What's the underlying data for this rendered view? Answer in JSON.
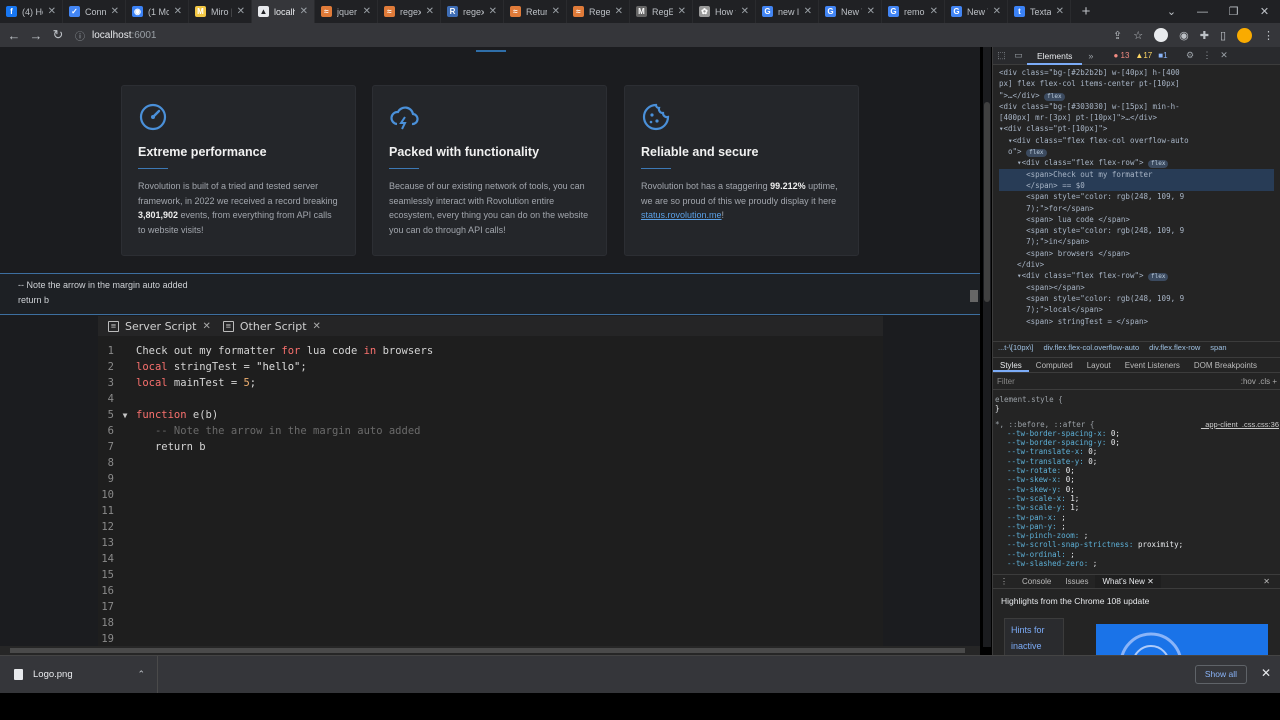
{
  "tabs": [
    {
      "title": "(4) Ho",
      "color": "#1877f2",
      "glyph": "f"
    },
    {
      "title": "Conn",
      "color": "#4285f4",
      "glyph": "✓"
    },
    {
      "title": "(1 Mc",
      "color": "#3b82f6",
      "glyph": "◉"
    },
    {
      "title": "Miro |",
      "color": "#f2c744",
      "glyph": "M"
    },
    {
      "title": "localh",
      "color": "#e8eaed",
      "glyph": "▲"
    },
    {
      "title": "jquer",
      "color": "#e07b39",
      "glyph": "≈"
    },
    {
      "title": "regex",
      "color": "#e07b39",
      "glyph": "≈"
    },
    {
      "title": "regex",
      "color": "#3e6db5",
      "glyph": "R"
    },
    {
      "title": "Return",
      "color": "#e07b39",
      "glyph": "≈"
    },
    {
      "title": "Regex",
      "color": "#e07b39",
      "glyph": "≈"
    },
    {
      "title": "RegEx",
      "color": "#666666",
      "glyph": "M"
    },
    {
      "title": "How t",
      "color": "#999999",
      "glyph": "✿"
    },
    {
      "title": "new li",
      "color": "#4285f4",
      "glyph": "G"
    },
    {
      "title": "New T",
      "color": "#4285f4",
      "glyph": "G"
    },
    {
      "title": "remo",
      "color": "#4285f4",
      "glyph": "G"
    },
    {
      "title": "New T",
      "color": "#4285f4",
      "glyph": "G"
    },
    {
      "title": "Texta",
      "color": "#3b82f6",
      "glyph": "t"
    }
  ],
  "url": {
    "host": "localhost",
    "port": ":6001"
  },
  "cards": [
    {
      "icon": "speedometer-icon",
      "title": "Extreme performance",
      "text_before": "Rovolution is built of a tried and tested server framework, in 2022 we received a record breaking ",
      "bold": "3,801,902",
      "text_after": " events, from everything from API calls to website visits!",
      "link": ""
    },
    {
      "icon": "cloud-lightning-icon",
      "title": "Packed with functionality",
      "text_before": "Because of our existing network of tools, you can seamlessly interact with Rovolution entire ecosystem, every thing you can do on the website you can do through API calls!",
      "bold": "",
      "text_after": "",
      "link": ""
    },
    {
      "icon": "cookie-icon",
      "title": "Reliable and secure",
      "text_before": "Rovolution bot has a staggering ",
      "bold": "99.212%",
      "text_after": " uptime, we are so proud of this we proudly display it here ",
      "link": "status.rovolution.me",
      "text_end": "!"
    }
  ],
  "tooltip": {
    "line1": "-- Note the arrow in the margin auto added",
    "line2": "return b"
  },
  "editor": {
    "tabs": [
      {
        "label": "Server Script"
      },
      {
        "label": "Other Script"
      }
    ],
    "lines": [
      {
        "n": "1",
        "fold": "",
        "parts": [
          [
            "",
            "Check out my formatter "
          ],
          [
            "kw",
            "for"
          ],
          [
            "",
            " lua code "
          ],
          [
            "kw",
            "in"
          ],
          [
            "",
            " browsers"
          ]
        ]
      },
      {
        "n": "2",
        "fold": "",
        "parts": [
          [
            "kw",
            "local"
          ],
          [
            "",
            " stringTest = "
          ],
          [
            "str",
            "\"hello\""
          ],
          [
            "",
            ";"
          ]
        ]
      },
      {
        "n": "3",
        "fold": "",
        "parts": [
          [
            "kw",
            "local"
          ],
          [
            "",
            " mainTest = "
          ],
          [
            "num-lit",
            "5"
          ],
          [
            "",
            ";"
          ]
        ]
      },
      {
        "n": "4",
        "fold": "",
        "parts": []
      },
      {
        "n": "5",
        "fold": "▼",
        "parts": [
          [
            "kw",
            "function"
          ],
          [
            "",
            " e(b)"
          ]
        ]
      },
      {
        "n": "6",
        "fold": "",
        "parts": [
          [
            "cmt",
            "   -- Note the arrow in the margin auto added"
          ]
        ]
      },
      {
        "n": "7",
        "fold": "",
        "parts": [
          [
            "",
            "   return b"
          ]
        ]
      },
      {
        "n": "8",
        "fold": "",
        "parts": []
      },
      {
        "n": "9",
        "fold": "",
        "parts": []
      },
      {
        "n": "10",
        "fold": "",
        "parts": []
      },
      {
        "n": "11",
        "fold": "",
        "parts": []
      },
      {
        "n": "12",
        "fold": "",
        "parts": []
      },
      {
        "n": "13",
        "fold": "",
        "parts": []
      },
      {
        "n": "14",
        "fold": "",
        "parts": []
      },
      {
        "n": "15",
        "fold": "",
        "parts": []
      },
      {
        "n": "16",
        "fold": "",
        "parts": []
      },
      {
        "n": "17",
        "fold": "",
        "parts": []
      },
      {
        "n": "18",
        "fold": "",
        "parts": []
      },
      {
        "n": "19",
        "fold": "",
        "parts": []
      }
    ]
  },
  "devtools": {
    "panel": "Elements",
    "errors": "13",
    "warnings": "17",
    "info": "1",
    "dom": [
      {
        "cls": "",
        "html": "&lt;div class=\"bg-[#2b2b2b] w-[40px] h-[400"
      },
      {
        "cls": "",
        "html": "px] flex flex-col items-center pt-[10px]"
      },
      {
        "cls": "",
        "html": "\"&gt;…&lt;/div&gt; <span class='flexb'>flex</span>"
      },
      {
        "cls": "",
        "html": "&lt;div class=\"bg-[#303030] w-[15px] min-h-"
      },
      {
        "cls": "",
        "html": "[400px] mr-[3px] pt-[10px]\"&gt;…&lt;/div&gt;"
      },
      {
        "cls": "",
        "html": "▾&lt;div class=\"pt-[10px]\"&gt;"
      },
      {
        "cls": "",
        "html": "  ▾&lt;div class=\"flex flex-col overflow-auto"
      },
      {
        "cls": "",
        "html": "  o\"&gt; <span class='flexb'>flex</span>"
      },
      {
        "cls": "",
        "html": "    ▾&lt;div class=\"flex flex-row\"&gt; <span class='flexb'>flex</span>"
      },
      {
        "cls": "sel",
        "html": "      &lt;span&gt;Check out my formatter"
      },
      {
        "cls": "sel",
        "html": "      &lt;/span&gt; == $0"
      },
      {
        "cls": "",
        "html": "      &lt;span style=\"color: rgb(248, 109, 9"
      },
      {
        "cls": "",
        "html": "      7);\"&gt;for&lt;/span&gt;"
      },
      {
        "cls": "",
        "html": "      &lt;span&gt; lua code &lt;/span&gt;"
      },
      {
        "cls": "",
        "html": "      &lt;span style=\"color: rgb(248, 109, 9"
      },
      {
        "cls": "",
        "html": "      7);\"&gt;in&lt;/span&gt;"
      },
      {
        "cls": "",
        "html": "      &lt;span&gt; browsers &lt;/span&gt;"
      },
      {
        "cls": "",
        "html": "    &lt;/div&gt;"
      },
      {
        "cls": "",
        "html": "    ▾&lt;div class=\"flex flex-row\"&gt; <span class='flexb'>flex</span>"
      },
      {
        "cls": "",
        "html": "      &lt;span&gt;&lt;/span&gt;"
      },
      {
        "cls": "",
        "html": "      &lt;span style=\"color: rgb(248, 109, 9"
      },
      {
        "cls": "",
        "html": "      7);\"&gt;local&lt;/span&gt;"
      },
      {
        "cls": "",
        "html": "      &lt;span&gt; stringTest = &lt;/span&gt;"
      }
    ],
    "crumbs": [
      "...t-\\[10px\\]",
      "div.flex.flex-col.overflow-auto",
      "div.flex.flex-row",
      "span"
    ],
    "style_tabs": [
      "Styles",
      "Computed",
      "Layout",
      "Event Listeners",
      "DOM Breakpoints"
    ],
    "filter_placeholder": "Filter",
    "filter_right": ":hov  .cls  +",
    "element_style": "element.style {",
    "selector": "*, ::before, ::after {",
    "source": "_app-client_.css.css:36",
    "props": [
      [
        "--tw-border-spacing-x",
        "0;"
      ],
      [
        "--tw-border-spacing-y",
        "0;"
      ],
      [
        "--tw-translate-x",
        "0;"
      ],
      [
        "--tw-translate-y",
        "0;"
      ],
      [
        "--tw-rotate",
        "0;"
      ],
      [
        "--tw-skew-x",
        "0;"
      ],
      [
        "--tw-skew-y",
        "0;"
      ],
      [
        "--tw-scale-x",
        "1;"
      ],
      [
        "--tw-scale-y",
        "1;"
      ],
      [
        "--tw-pan-x",
        ";"
      ],
      [
        "--tw-pan-y",
        ";"
      ],
      [
        "--tw-pinch-zoom",
        ";"
      ],
      [
        "--tw-scroll-snap-strictness",
        "proximity;"
      ],
      [
        "--tw-ordinal",
        ";"
      ],
      [
        "--tw-slashed-zero",
        ";"
      ]
    ],
    "drawer_tabs": [
      "Console",
      "Issues",
      "What's New"
    ],
    "whats_new": "Highlights from the Chrome 108 update",
    "hint": "Hints for inactive"
  },
  "download": {
    "file": "Logo.png",
    "show_all": "Show all"
  }
}
